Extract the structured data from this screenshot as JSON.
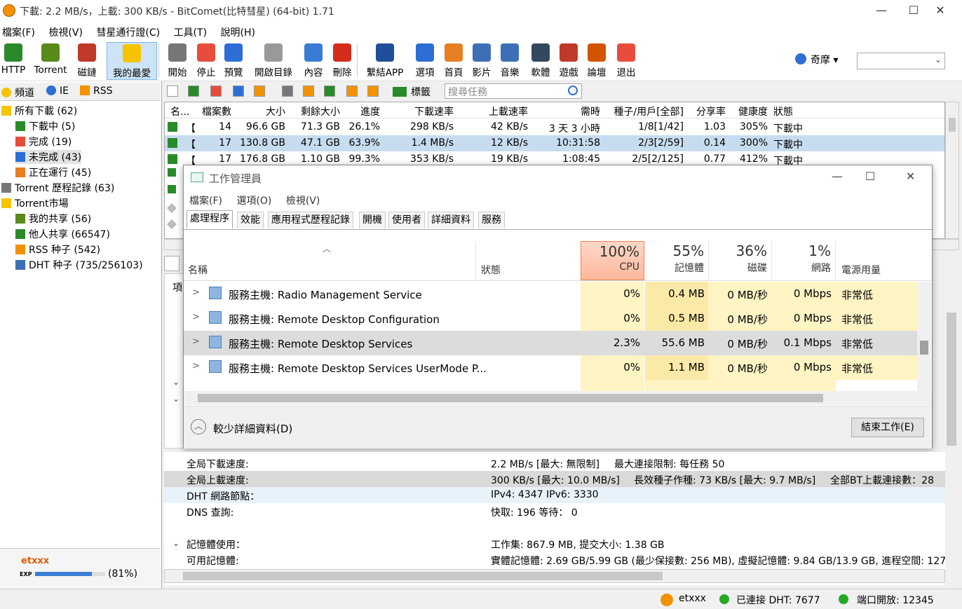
{
  "window": {
    "title": "下載: 2.2 MB/s，上載: 300 KB/s - BitComet(比特彗星) (64-bit) 1.71",
    "controls": {
      "min": "—",
      "max": "☐",
      "close": "✕"
    }
  },
  "menu": [
    "檔案(F)",
    "檢視(V)",
    "彗星通行證(C)",
    "工具(T)",
    "說明(H)"
  ],
  "toolbar": [
    {
      "label": "HTTP",
      "color": "#2a8a2a"
    },
    {
      "label": "Torrent",
      "color": "#5a8a1a"
    },
    {
      "label": "磁鏈",
      "color": "#c0392b"
    },
    {
      "label": "我的最愛",
      "color": "#f5c400"
    },
    {
      "label": "開始",
      "color": "#777777"
    },
    {
      "label": "停止",
      "color": "#e74c3c"
    },
    {
      "label": "預覽",
      "color": "#2c6ed5"
    },
    {
      "label": "開啟目錄",
      "color": "#999999"
    },
    {
      "label": "內容",
      "color": "#3a7bd5"
    },
    {
      "label": "刪除",
      "color": "#d62c1a"
    },
    {
      "label": "繫結APP",
      "color": "#1f4e9a"
    },
    {
      "label": "選項",
      "color": "#2c6ed5"
    },
    {
      "label": "首頁",
      "color": "#e67e22"
    },
    {
      "label": "影片",
      "color": "#3d6fb6"
    },
    {
      "label": "音樂",
      "color": "#3d6fb6"
    },
    {
      "label": "軟體",
      "color": "#34495e"
    },
    {
      "label": "遊戲",
      "color": "#c0392b"
    },
    {
      "label": "論壇",
      "color": "#d35400"
    },
    {
      "label": "退出",
      "color": "#e74c3c"
    }
  ],
  "region": {
    "label": "奇摩 ▾"
  },
  "left_tabs": [
    "頻道",
    "IE",
    "RSS"
  ],
  "tree": [
    {
      "label": "所有下載 (62)",
      "icon": "folder"
    },
    {
      "label": "下載中 (5)",
      "icon": "arrow-down"
    },
    {
      "label": "完成 (19)",
      "icon": "checkmark"
    },
    {
      "label": "未完成 (43)",
      "icon": "bar-chart"
    },
    {
      "label": "正在運行 (45)",
      "icon": "arrows-updown"
    },
    {
      "label": "Torrent 歷程記錄 (63)",
      "icon": "clock"
    },
    {
      "label": "Torrent市場",
      "icon": "folder"
    },
    {
      "label": "我的共享 (56)",
      "icon": "share"
    },
    {
      "label": "他人共享 (66547)",
      "icon": "share-others"
    },
    {
      "label": "RSS 种子 (542)",
      "icon": "rss"
    },
    {
      "label": "DHT 种子 (735/256103)",
      "icon": "dht"
    }
  ],
  "user": {
    "name": "etxxx",
    "exp_label": "EXP",
    "exp_pct_text": "(81%)",
    "exp_fraction": 0.81
  },
  "task_toolbar": {
    "tags_label": "標籤",
    "search_placeholder": "搜尋任務"
  },
  "grid": {
    "columns": [
      "名...",
      "檔案數",
      "大小",
      "剩餘大小",
      "進度",
      "下載速率",
      "上載速率",
      "需時",
      "種子/用戶[全部]",
      "分享率",
      "健康度",
      "狀態"
    ],
    "rows": [
      [
        "【",
        "14",
        "96.6 GB",
        "71.3 GB",
        "26.1%",
        "298 KB/s",
        "42 KB/s",
        "3 天 3 小時",
        "1/8[1/42]",
        "1.03",
        "305%",
        "下載中"
      ],
      [
        "【",
        "17",
        "130.8 GB",
        "47.1 GB",
        "63.9%",
        "1.4 MB/s",
        "12 KB/s",
        "10:31:58",
        "2/3[2/59]",
        "0.14",
        "300%",
        "下載中"
      ],
      [
        "【",
        "17",
        "176.8 GB",
        "1.10 GB",
        "99.3%",
        "353 KB/s",
        "19 KB/s",
        "1:08:45",
        "2/5[2/125]",
        "0.77",
        "412%",
        "下載中"
      ]
    ]
  },
  "task_manager": {
    "title": "工作管理員",
    "menu": [
      "檔案(F)",
      "選項(O)",
      "檢視(V)"
    ],
    "tabs": [
      "處理程序",
      "效能",
      "應用程式歷程記錄",
      "開機",
      "使用者",
      "詳細資料",
      "服務"
    ],
    "headers": {
      "name": "名稱",
      "status": "狀態",
      "power": "電源用量"
    },
    "metrics": [
      {
        "pct": "100%",
        "label": "CPU"
      },
      {
        "pct": "55%",
        "label": "記憶體"
      },
      {
        "pct": "36%",
        "label": "磁碟"
      },
      {
        "pct": "1%",
        "label": "網路"
      }
    ],
    "rows": [
      {
        "name": "服務主機: Radio Management Service",
        "cpu": "0%",
        "mem": "0.4 MB",
        "disk": "0 MB/秒",
        "net": "0 Mbps",
        "power": "非常低"
      },
      {
        "name": "服務主機: Remote Desktop Configuration",
        "cpu": "0%",
        "mem": "0.5 MB",
        "disk": "0 MB/秒",
        "net": "0 Mbps",
        "power": "非常低"
      },
      {
        "name": "服務主機: Remote Desktop Services",
        "cpu": "2.3%",
        "mem": "55.6 MB",
        "disk": "0 MB/秒",
        "net": "0.1 Mbps",
        "power": "非常低"
      },
      {
        "name": "服務主機: Remote Desktop Services UserMode P...",
        "cpu": "0%",
        "mem": "1.1 MB",
        "disk": "0 MB/秒",
        "net": "0 Mbps",
        "power": "非常低"
      }
    ],
    "fewer_details": "較少詳細資料(D)",
    "end_task": "結束工作(E)"
  },
  "stats": [
    {
      "label": "全局下載速度:",
      "value": "2.2 MB/s [最大: 無限制]",
      "extra": "最大連接限制: 每任務 50"
    },
    {
      "label": "全局上載速度:",
      "value": "300 KB/s [最大: 10.0 MB/s]",
      "extra": "長效種子作種: 73 KB/s [最大: 9.7 MB/s]",
      "extra2": "全部BT上載連接數：28"
    },
    {
      "label": "DHT 網路節點：",
      "value": "IPv4: 4347  IPv6: 3330"
    },
    {
      "label": "DNS 查詢:",
      "value": "快取: 196   等待： 0"
    },
    {
      "label": "記憶體使用：",
      "value": "工作集: 867.9 MB, 提交大小: 1.38 GB"
    },
    {
      "label": "可用記憶體:",
      "value": "實體記憶體: 2.69 GB/5.99 GB (最少保接數: 256 MB), 虛擬記憶體: 9.84 GB/13.9 GB, 進程空間: 127"
    }
  ],
  "status": {
    "user": "etxxx",
    "dht": "已連接 DHT: 7677",
    "port": "端口開放: 12345"
  }
}
